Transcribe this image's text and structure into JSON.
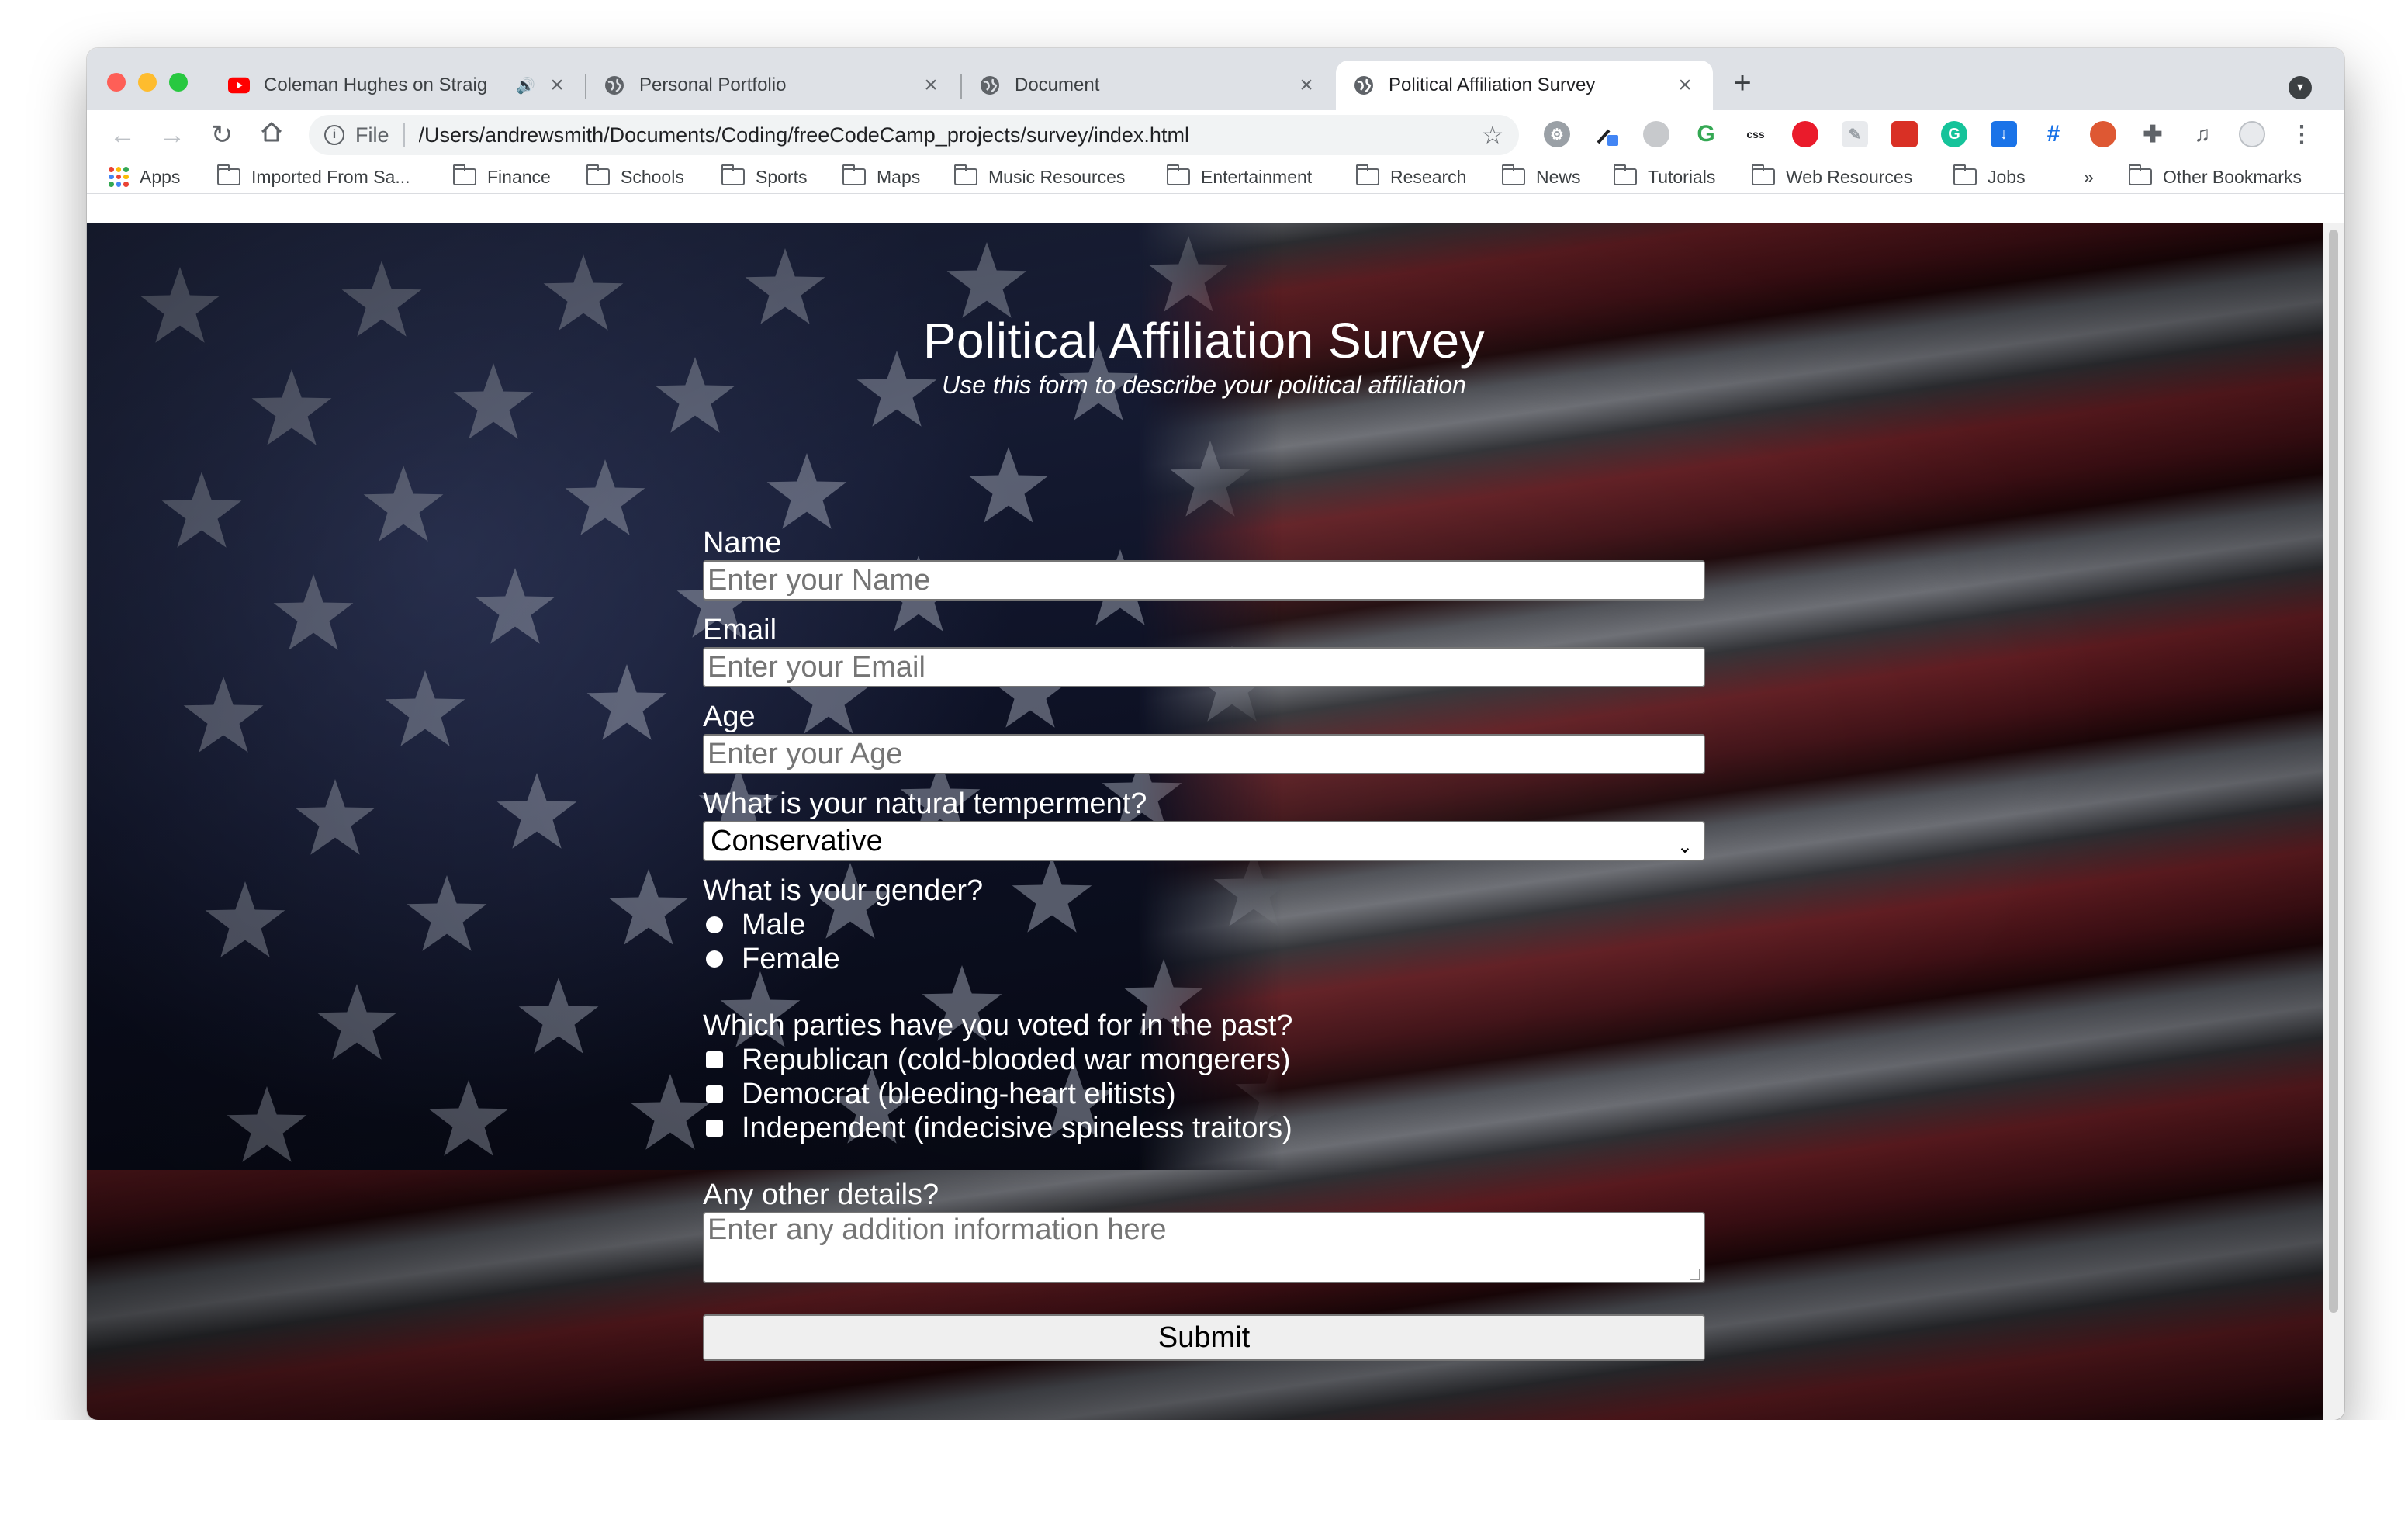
{
  "browser": {
    "tabs": [
      {
        "title": "Coleman Hughes on Straig",
        "favicon": "youtube-icon",
        "audio": true,
        "active": false
      },
      {
        "title": "Personal Portfolio",
        "favicon": "globe-icon",
        "active": false
      },
      {
        "title": "Document",
        "favicon": "globe-icon",
        "active": false
      },
      {
        "title": "Political Affiliation Survey",
        "favicon": "globe-icon",
        "active": true
      }
    ],
    "new_tab": "+",
    "scheme_label": "File",
    "url": "/Users/andrewsmith/Documents/Coding/freeCodeCamp_projects/survey/index.html",
    "bookmarks": [
      "Apps",
      "Imported From Sa...",
      "Finance",
      "Schools",
      "Sports",
      "Maps",
      "Music Resources",
      "Entertainment",
      "Research",
      "News",
      "Tutorials",
      "Web Resources",
      "Jobs"
    ],
    "bookmarks_overflow": "»",
    "other_bookmarks": "Other Bookmarks",
    "colors": {
      "tabstrip": "#dee1e6",
      "omnibox": "#f1f3f4"
    }
  },
  "page": {
    "title": "Political Affiliation Survey",
    "subtitle": "Use this form to describe your political affiliation",
    "background": "american-flag",
    "form": {
      "name_label": "Name",
      "name_placeholder": "Enter your Name",
      "email_label": "Email",
      "email_placeholder": "Enter your Email",
      "age_label": "Age",
      "age_placeholder": "Enter your Age",
      "temperament_label": "What is your natural temperment?",
      "temperament_value": "Conservative",
      "gender_label": "What is your gender?",
      "gender_options": [
        "Male",
        "Female"
      ],
      "parties_label": "Which parties have you voted for in the past?",
      "parties_options": [
        "Republican (cold-blooded war mongerers)",
        "Democrat (bleeding-heart elitists)",
        "Independent (indecisive spineless traitors)"
      ],
      "details_label": "Any other details?",
      "details_placeholder": "Enter any addition information here",
      "submit_label": "Submit"
    }
  }
}
